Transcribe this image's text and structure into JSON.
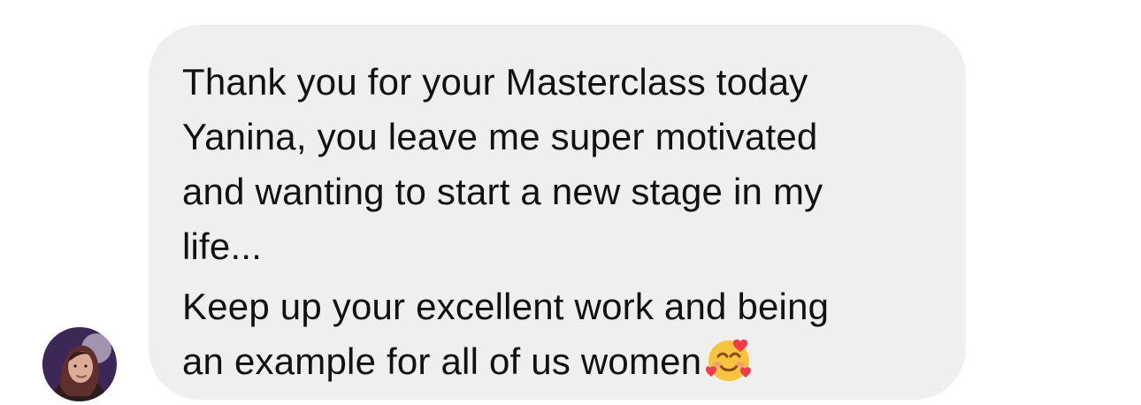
{
  "message": {
    "lines": [
      "Thank you for your Masterclass today",
      "Yanina, you leave me super motivated",
      "and wanting to start a new stage in my",
      "life...",
      "Keep up your excellent work and being",
      "an example for all of us women"
    ],
    "emoji": "🥰"
  },
  "colors": {
    "bubble_background": "#efefef",
    "text": "#111111",
    "page_background": "#ffffff"
  },
  "icons": {
    "avatar": "profile-avatar",
    "emoji": "smiling-face-with-hearts-icon"
  }
}
